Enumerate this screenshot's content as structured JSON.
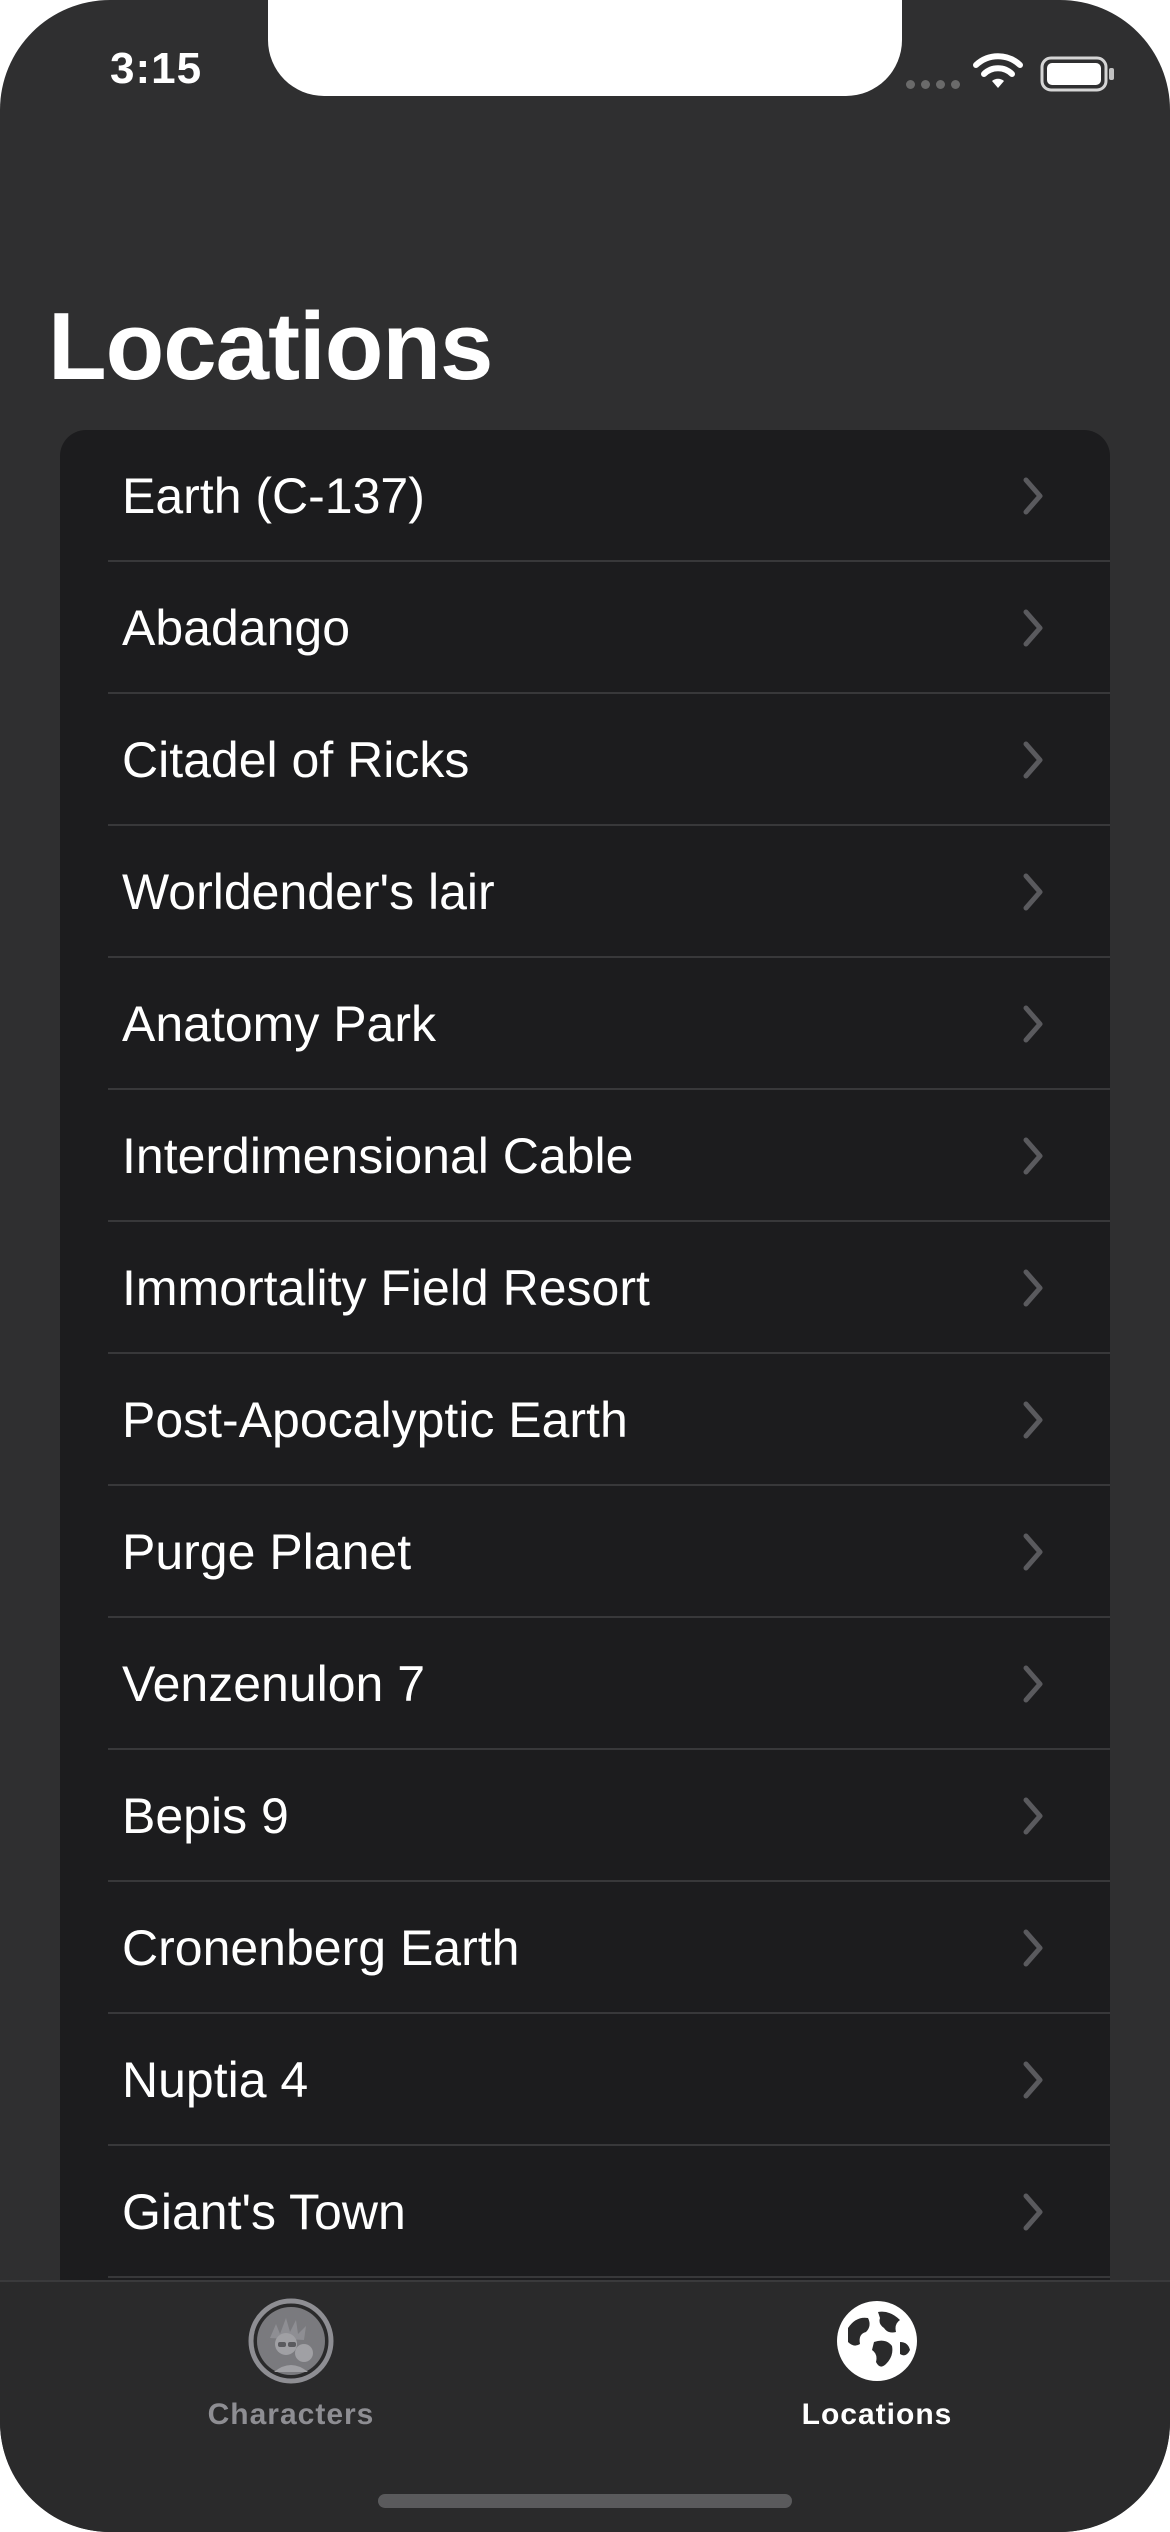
{
  "status_bar": {
    "time": "3:15",
    "wifi_icon": "wifi-icon",
    "battery_icon": "battery-icon"
  },
  "header": {
    "title": "Locations"
  },
  "locations": [
    {
      "label": "Earth (C-137)"
    },
    {
      "label": "Abadango"
    },
    {
      "label": "Citadel of Ricks"
    },
    {
      "label": "Worldender's lair"
    },
    {
      "label": "Anatomy Park"
    },
    {
      "label": "Interdimensional Cable"
    },
    {
      "label": "Immortality Field Resort"
    },
    {
      "label": "Post-Apocalyptic Earth"
    },
    {
      "label": "Purge Planet"
    },
    {
      "label": "Venzenulon 7"
    },
    {
      "label": "Bepis 9"
    },
    {
      "label": "Cronenberg Earth"
    },
    {
      "label": "Nuptia 4"
    },
    {
      "label": "Giant's Town"
    }
  ],
  "tab_bar": {
    "tabs": [
      {
        "label": "Characters",
        "icon": "characters-icon",
        "selected": false
      },
      {
        "label": "Locations",
        "icon": "globe-icon",
        "selected": true
      }
    ]
  },
  "colors": {
    "background": "#2f2f30",
    "list_background": "#1c1c1e",
    "text": "#ffffff",
    "inactive_tab": "#8e8e93",
    "chevron": "#5a5a5e"
  }
}
